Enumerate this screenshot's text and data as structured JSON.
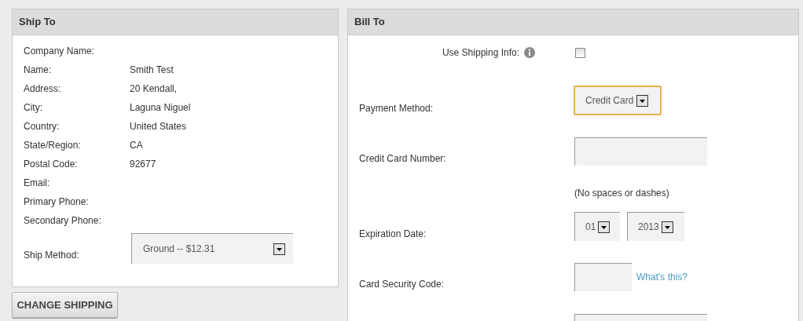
{
  "ship_to": {
    "title": "Ship To",
    "fields": [
      {
        "label": "Company Name:"
      },
      {
        "label": "Name:",
        "value": "Smith Test"
      },
      {
        "label": "Address:",
        "value": "20 Kendall,"
      },
      {
        "label": "City:",
        "value": "Laguna Niguel"
      },
      {
        "label": "Country:",
        "value": "United States"
      },
      {
        "label": "State/Region:",
        "value": "CA"
      },
      {
        "label": "Postal Code:",
        "value": "92677"
      },
      {
        "label": "Email:"
      },
      {
        "label": "Primary Phone:"
      },
      {
        "label": "Secondary Phone:"
      }
    ],
    "ship_method": {
      "label": "Ship Method:",
      "value": "Ground -- $12.31"
    }
  },
  "change_shipping_button": "CHANGE SHIPPING",
  "bill_to": {
    "title": "Bill To",
    "use_shipping_info": {
      "label": "Use Shipping Info:",
      "checked": false
    },
    "payment_method": {
      "label": "Payment Method:",
      "value": "Credit Card"
    },
    "card_number": {
      "label": "Credit Card Number:",
      "note": "(No spaces or dashes)"
    },
    "expiration": {
      "label": "Expiration Date:",
      "month": "01",
      "year": "2013"
    },
    "security_code": {
      "label": "Card Security Code:",
      "link": "What's this?"
    }
  }
}
